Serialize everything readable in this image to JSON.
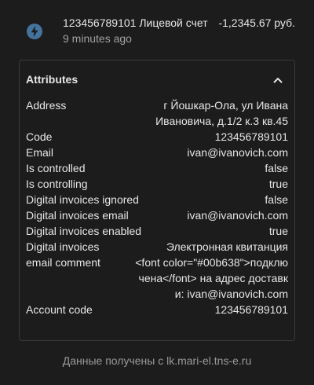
{
  "entity": {
    "name": "123456789101 Лицевой счет",
    "value": "-1,2345.67 руб.",
    "time": "9 minutes ago",
    "icon": "lightning-bolt-icon",
    "icon_color": "#44739e"
  },
  "attributes": {
    "title": "Attributes",
    "rows": [
      {
        "key": "Address",
        "value": "г Йошкар-Ола, ул Ивана Ивановича, д.1/2 к.3 кв.45"
      },
      {
        "key": "Code",
        "value": "123456789101"
      },
      {
        "key": "Email",
        "value": "ivan@ivanovich.com"
      },
      {
        "key": "Is controlled",
        "value": "false"
      },
      {
        "key": "Is controlling",
        "value": "true"
      },
      {
        "key": "Digital invoices ignored",
        "value": "false"
      },
      {
        "key": "Digital invoices email",
        "value": "ivan@ivanovich.com"
      },
      {
        "key": "Digital invoices enabled",
        "value": "true"
      },
      {
        "key": "Digital invoices",
        "value": "Электронная квитанция"
      },
      {
        "key": "email comment",
        "value": "<font color=\"#00b638\">подключена</font> на адрес доставки: ivan@ivanovich.com"
      },
      {
        "key": "Account code",
        "value": "123456789101"
      }
    ]
  },
  "footer": {
    "text": "Данные получены с lk.mari-el.tns-e.ru"
  }
}
